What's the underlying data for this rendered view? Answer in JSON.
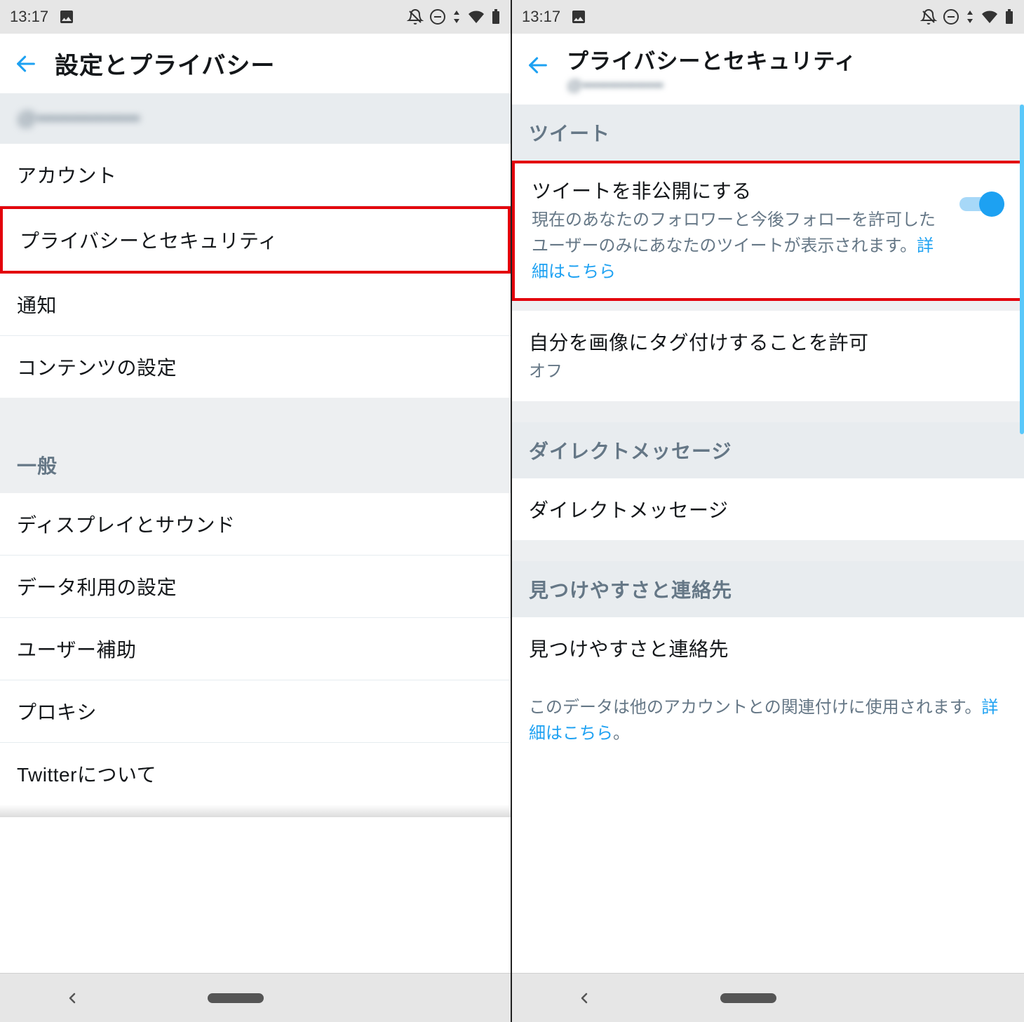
{
  "status": {
    "time": "13:17"
  },
  "left": {
    "title": "設定とプライバシー",
    "account_handle": "@•••••••••••••••",
    "items": {
      "account": "アカウント",
      "privacy": "プライバシーとセキュリティ",
      "notifications": "通知",
      "content": "コンテンツの設定"
    },
    "general_header": "一般",
    "general_items": {
      "display_sound": "ディスプレイとサウンド",
      "data_usage": "データ利用の設定",
      "accessibility": "ユーザー補助",
      "proxy": "プロキシ",
      "about": "Twitterについて"
    }
  },
  "right": {
    "title": "プライバシーとセキュリティ",
    "subtitle_handle": "@•••••••••••••••",
    "tweets_header": "ツイート",
    "protect": {
      "title": "ツイートを非公開にする",
      "desc": "現在のあなたのフォロワーと今後フォローを許可したユーザーのみにあなたのツイートが表示されます。",
      "link": "詳細はこちら"
    },
    "photo_tag": {
      "title": "自分を画像にタグ付けすることを許可",
      "sub": "オフ"
    },
    "dm_header": "ダイレクトメッセージ",
    "dm_item": "ダイレクトメッセージ",
    "discover_header": "見つけやすさと連絡先",
    "discover_item": "見つけやすさと連絡先",
    "info_text": "このデータは他のアカウントとの関連付けに使用されます。",
    "info_link": "詳細はこちら",
    "info_period": "。"
  }
}
